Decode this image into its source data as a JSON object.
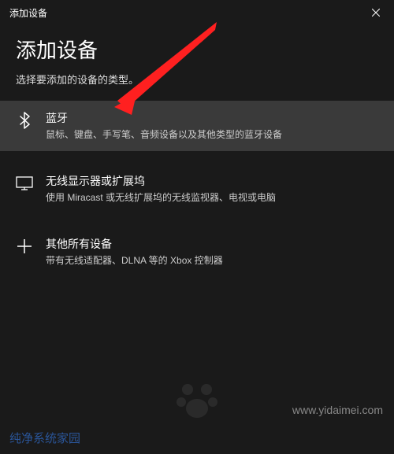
{
  "titlebar": {
    "title": "添加设备"
  },
  "header": {
    "title": "添加设备",
    "subtitle": "选择要添加的设备的类型。"
  },
  "options": [
    {
      "title": "蓝牙",
      "desc": "鼠标、键盘、手写笔、音频设备以及其他类型的蓝牙设备"
    },
    {
      "title": "无线显示器或扩展坞",
      "desc": "使用 Miracast 或无线扩展坞的无线监视器、电视或电脑"
    },
    {
      "title": "其他所有设备",
      "desc": "带有无线适配器、DLNA 等的 Xbox 控制器"
    }
  ],
  "watermarks": {
    "url": "www.yidaimei.com",
    "brand": "纯净系统家园"
  }
}
